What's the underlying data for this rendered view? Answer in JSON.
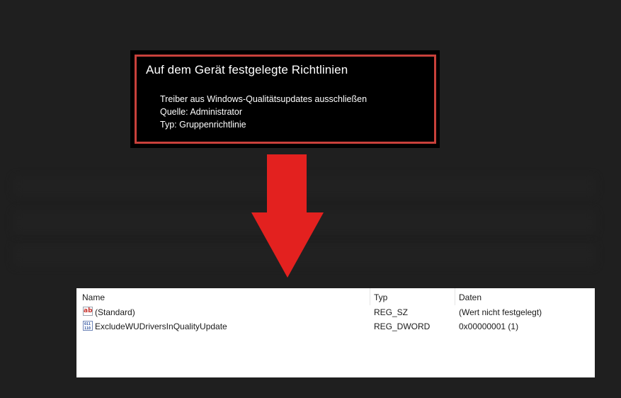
{
  "policy": {
    "title": "Auf dem Gerät festgelegte Richtlinien",
    "lines": [
      "Treiber aus Windows-Qualitätsupdates ausschließen",
      "Quelle: Administrator",
      "Typ: Gruppenrichtlinie"
    ]
  },
  "registry": {
    "columns": [
      "Name",
      "Typ",
      "Daten"
    ],
    "rows": [
      {
        "icon": "string-value-icon",
        "name": "(Standard)",
        "type": "REG_SZ",
        "data": "(Wert nicht festgelegt)"
      },
      {
        "icon": "binary-value-icon",
        "name": "ExcludeWUDriversInQualityUpdate",
        "type": "REG_DWORD",
        "data": "0x00000001 (1)"
      }
    ]
  },
  "icons": {
    "ab_glyph": "ab",
    "bin_glyph": "011\n110"
  },
  "colors": {
    "background": "#1f1f1f",
    "frame": "#c9413b",
    "arrow": "#e3211f"
  }
}
